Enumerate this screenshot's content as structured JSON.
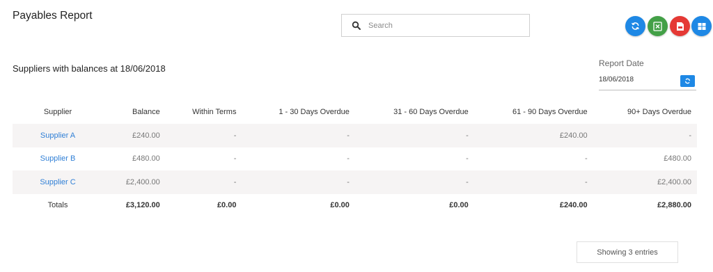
{
  "header": {
    "title": "Payables Report"
  },
  "search": {
    "placeholder": "Search",
    "value": ""
  },
  "actions": [
    {
      "name": "refresh",
      "icon": "refresh-icon",
      "color": "#1e88e5"
    },
    {
      "name": "export-excel",
      "icon": "excel-icon",
      "color": "#43a047"
    },
    {
      "name": "export-pdf",
      "icon": "pdf-icon",
      "color": "#e53935"
    },
    {
      "name": "grid-view",
      "icon": "grid-icon",
      "color": "#1e88e5"
    }
  ],
  "report": {
    "subtitle": "Suppliers with balances at 18/06/2018",
    "date_label": "Report Date",
    "date_value": "18/06/2018"
  },
  "table": {
    "columns": [
      "Supplier",
      "Balance",
      "Within Terms",
      "1 - 30 Days Overdue",
      "31 - 60 Days Overdue",
      "61 - 90 Days Overdue",
      "90+ Days Overdue"
    ],
    "rows": [
      [
        "Supplier A",
        "£240.00",
        "-",
        "-",
        "-",
        "£240.00",
        "-"
      ],
      [
        "Supplier B",
        "£480.00",
        "-",
        "-",
        "-",
        "-",
        "£480.00"
      ],
      [
        "Supplier C",
        "£2,400.00",
        "-",
        "-",
        "-",
        "-",
        "£2,400.00"
      ]
    ],
    "totals": [
      "Totals",
      "£3,120.00",
      "£0.00",
      "£0.00",
      "£0.00",
      "£240.00",
      "£2,880.00"
    ]
  },
  "footer": {
    "entries_text": "Showing 3 entries"
  },
  "colors": {
    "accent": "#1e88e5",
    "link": "#2f7fd6",
    "excel": "#43a047",
    "pdf": "#e53935",
    "row_stripe": "#f6f4f4"
  }
}
